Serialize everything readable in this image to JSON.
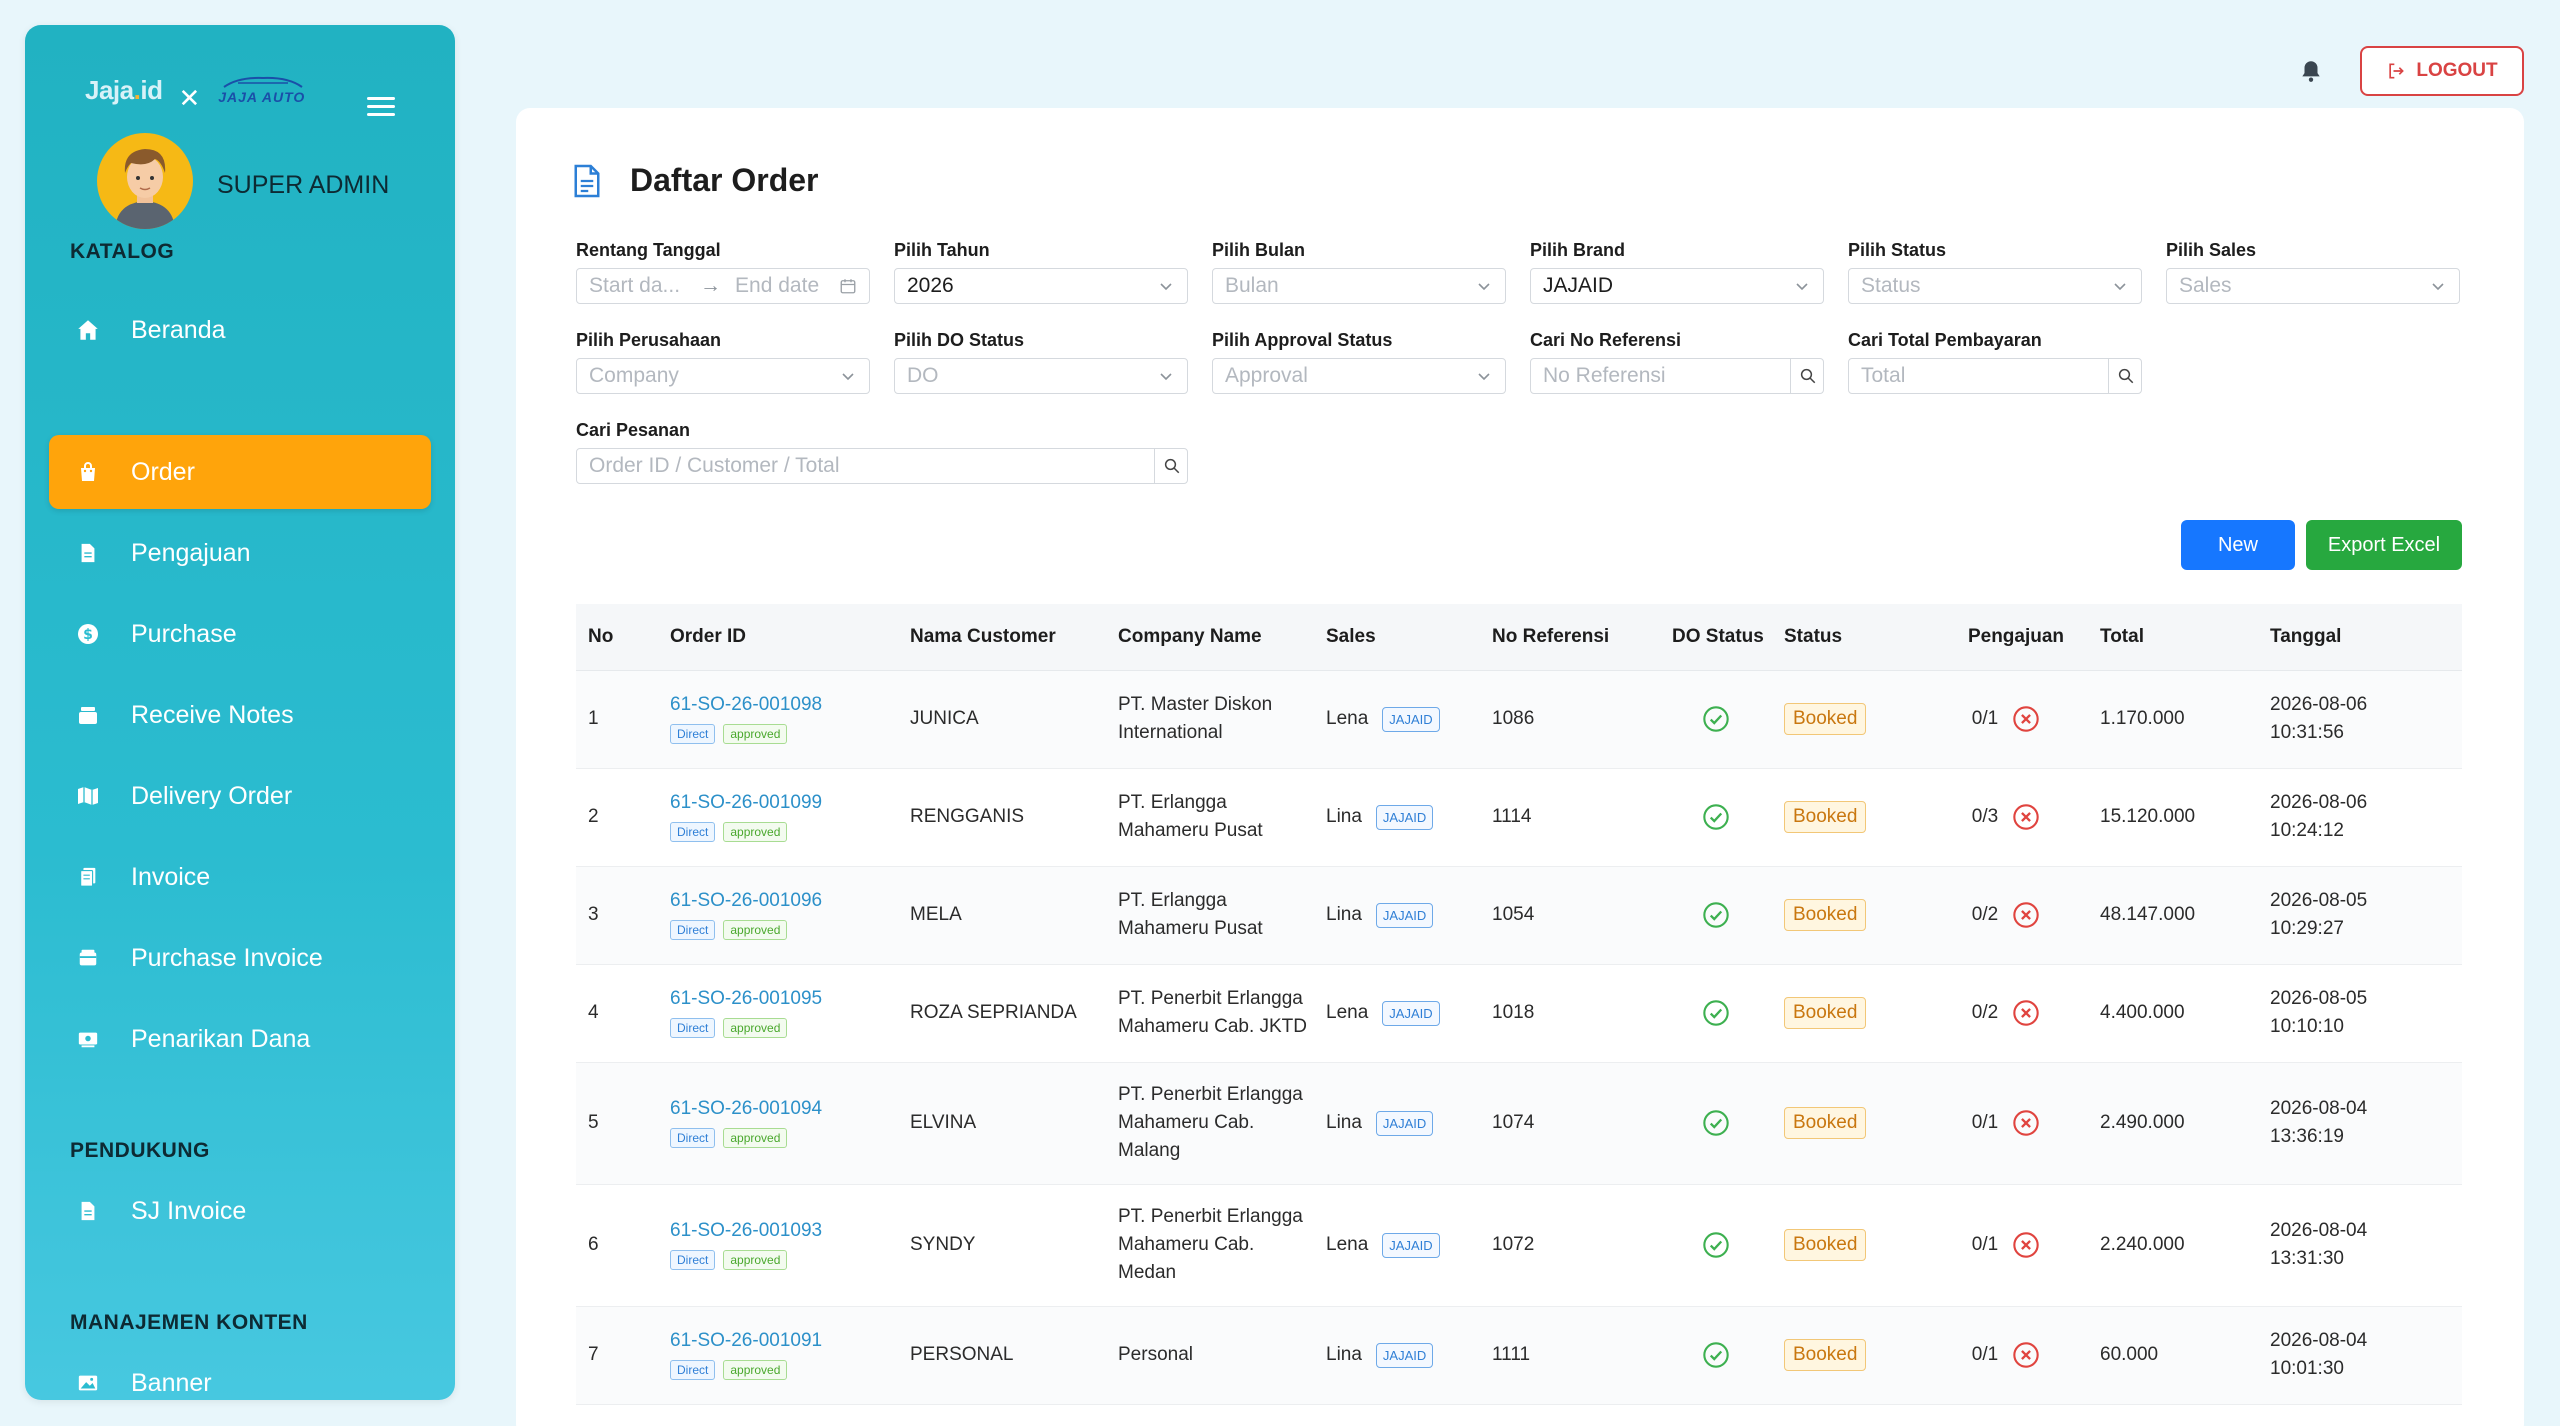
{
  "sidebar": {
    "brand_left": "Jaja.id",
    "brand_right": "JAJA AUTO",
    "user": "SUPER ADMIN",
    "nav_top": {
      "label": "Beranda",
      "icon": "home-icon"
    },
    "sections": {
      "katalog": "KATALOG",
      "pendukung": "PENDUKUNG",
      "manajemen": "MANAJEMEN KONTEN"
    },
    "katalog_items": [
      {
        "label": "Order",
        "icon": "shopping-bag-icon",
        "active": true
      },
      {
        "label": "Pengajuan",
        "icon": "document-icon"
      },
      {
        "label": "Purchase",
        "icon": "dollar-icon"
      },
      {
        "label": "Receive Notes",
        "icon": "inbox-icon"
      },
      {
        "label": "Delivery Order",
        "icon": "map-icon"
      },
      {
        "label": "Invoice",
        "icon": "invoice-icon"
      },
      {
        "label": "Purchase Invoice",
        "icon": "wallet-icon"
      },
      {
        "label": "Penarikan Dana",
        "icon": "cash-icon"
      }
    ],
    "pendukung_items": [
      {
        "label": "SJ Invoice",
        "icon": "document-icon"
      }
    ],
    "manajemen_items": [
      {
        "label": "Banner",
        "icon": "image-icon"
      }
    ]
  },
  "topbar": {
    "logout": "LOGOUT"
  },
  "page": {
    "title": "Daftar Order"
  },
  "filters": {
    "rentang_label": "Rentang Tanggal",
    "start_ph": "Start da...",
    "end_ph": "End date",
    "tahun_label": "Pilih Tahun",
    "tahun_val": "2026",
    "bulan_label": "Pilih Bulan",
    "bulan_ph": "Bulan",
    "brand_label": "Pilih Brand",
    "brand_val": "JAJAID",
    "status_label": "Pilih Status",
    "status_ph": "Status",
    "sales_label": "Pilih Sales",
    "sales_ph": "Sales",
    "perusahaan_label": "Pilih Perusahaan",
    "perusahaan_ph": "Company",
    "do_label": "Pilih DO Status",
    "do_ph": "DO",
    "approval_label": "Pilih Approval Status",
    "approval_ph": "Approval",
    "ref_label": "Cari No Referensi",
    "ref_ph": "No Referensi",
    "total_label": "Cari Total Pembayaran",
    "total_ph": "Total",
    "pesanan_label": "Cari Pesanan",
    "pesanan_ph": "Order ID / Customer / Total"
  },
  "actions": {
    "new": "New",
    "export": "Export Excel"
  },
  "table": {
    "headers": [
      "No",
      "Order ID",
      "Nama Customer",
      "Company Name",
      "Sales",
      "No Referensi",
      "DO Status",
      "Status",
      "Pengajuan",
      "Total",
      "Tanggal"
    ],
    "tag_direct": "Direct",
    "tag_approved": "approved",
    "rows": [
      {
        "no": "1",
        "order_id": "61-SO-26-001098",
        "customer": "JUNICA",
        "company": [
          "PT. Master Diskon",
          "International"
        ],
        "sales": "Lena",
        "brand": "JAJAID",
        "ref": "1086",
        "status": "Booked",
        "pengajuan": "0/1",
        "total": "1.170.000",
        "date": "2026-08-06",
        "time": "10:31:56"
      },
      {
        "no": "2",
        "order_id": "61-SO-26-001099",
        "customer": "RENGGANIS",
        "company": [
          "PT. Erlangga",
          "Mahameru Pusat"
        ],
        "sales": "Lina",
        "brand": "JAJAID",
        "ref": "1114",
        "status": "Booked",
        "pengajuan": "0/3",
        "total": "15.120.000",
        "date": "2026-08-06",
        "time": "10:24:12"
      },
      {
        "no": "3",
        "order_id": "61-SO-26-001096",
        "customer": "MELA",
        "company": [
          "PT. Erlangga",
          "Mahameru Pusat"
        ],
        "sales": "Lina",
        "brand": "JAJAID",
        "ref": "1054",
        "status": "Booked",
        "pengajuan": "0/2",
        "total": "48.147.000",
        "date": "2026-08-05",
        "time": "10:29:27"
      },
      {
        "no": "4",
        "order_id": "61-SO-26-001095",
        "customer": "ROZA SEPRIANDA",
        "company": [
          "PT. Penerbit Erlangga",
          "Mahameru Cab. JKTD"
        ],
        "sales": "Lena",
        "brand": "JAJAID",
        "ref": "1018",
        "status": "Booked",
        "pengajuan": "0/2",
        "total": "4.400.000",
        "date": "2026-08-05",
        "time": "10:10:10"
      },
      {
        "no": "5",
        "order_id": "61-SO-26-001094",
        "customer": "ELVINA",
        "company": [
          "PT. Penerbit Erlangga",
          "Mahameru Cab.",
          "Malang"
        ],
        "sales": "Lina",
        "brand": "JAJAID",
        "ref": "1074",
        "status": "Booked",
        "pengajuan": "0/1",
        "total": "2.490.000",
        "date": "2026-08-04",
        "time": "13:36:19"
      },
      {
        "no": "6",
        "order_id": "61-SO-26-001093",
        "customer": "SYNDY",
        "company": [
          "PT. Penerbit Erlangga",
          "Mahameru Cab.",
          "Medan"
        ],
        "sales": "Lena",
        "brand": "JAJAID",
        "ref": "1072",
        "status": "Booked",
        "pengajuan": "0/1",
        "total": "2.240.000",
        "date": "2026-08-04",
        "time": "13:31:30"
      },
      {
        "no": "7",
        "order_id": "61-SO-26-001091",
        "customer": "PERSONAL",
        "company": [
          "Personal"
        ],
        "sales": "Lina",
        "brand": "JAJAID",
        "ref": "1111",
        "status": "Booked",
        "pengajuan": "0/1",
        "total": "60.000",
        "date": "2026-08-04",
        "time": "10:01:30"
      }
    ]
  },
  "colors": {
    "accent": "#ffa40b",
    "sidebar": "#21b2c2",
    "primary": "#1677ff",
    "export": "#27a83f",
    "danger": "#d94343"
  }
}
